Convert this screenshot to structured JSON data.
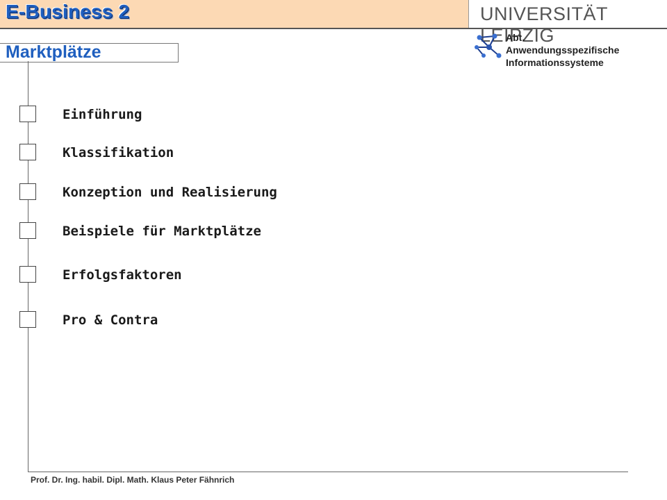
{
  "header": {
    "course_title": "E-Business 2",
    "university": "UNIVERSITÄT LEIPZIG"
  },
  "department": {
    "line1": "Abt.",
    "line2": "Anwendungsspezifische",
    "line3": "Informationssysteme",
    "logo_icon": "network-graph-icon"
  },
  "section": {
    "title": "Marktplätze"
  },
  "agenda": [
    {
      "label": "Einführung"
    },
    {
      "label": "Klassifikation"
    },
    {
      "label": "Konzeption und Realisierung"
    },
    {
      "label": "Beispiele für Marktplätze"
    },
    {
      "label": "Erfolgsfaktoren"
    },
    {
      "label": "Pro & Contra"
    }
  ],
  "footer": {
    "author": "Prof. Dr. Ing. habil. Dipl. Math. Klaus Peter Fähnrich"
  },
  "colors": {
    "header_bg": "#fcd9b4",
    "title_blue": "#1f5fbf"
  }
}
